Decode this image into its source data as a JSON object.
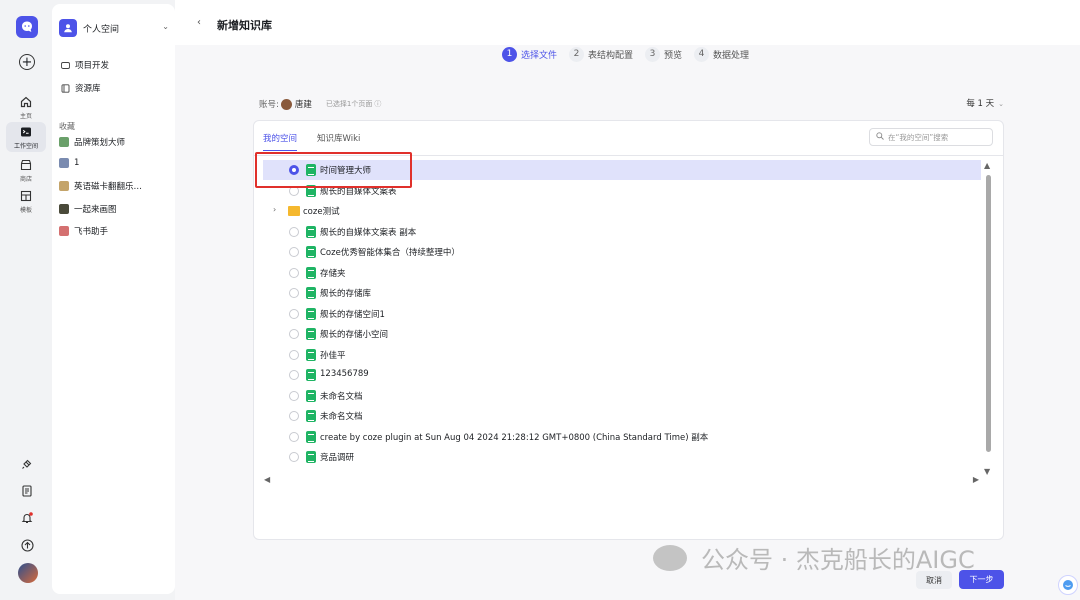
{
  "rail": {
    "items": [
      {
        "label": "主页",
        "icon": "home-icon"
      },
      {
        "label": "工作空间",
        "icon": "workspace-icon"
      },
      {
        "label": "商店",
        "icon": "store-icon"
      },
      {
        "label": "模板",
        "icon": "template-icon"
      }
    ],
    "bottom_icons": [
      "plugin-icon",
      "doc-icon",
      "bell-icon",
      "upload-icon"
    ],
    "notification_color": "#e0302b",
    "accent": "#4d53e8"
  },
  "sidebar": {
    "space_name": "个人空间",
    "nav": [
      {
        "label": "项目开发",
        "icon": "project-icon"
      },
      {
        "label": "资源库",
        "icon": "library-icon"
      }
    ],
    "favorites_title": "收藏",
    "favorites": [
      {
        "label": "品牌策划大师",
        "color": "#6aa06a"
      },
      {
        "label": "1",
        "color": "#7a8bb0"
      },
      {
        "label": "英语磁卡翻翻乐…",
        "color": "#c4a46a"
      },
      {
        "label": "一起来画图",
        "color": "#4a4a3a"
      },
      {
        "label": "飞书助手",
        "color": "#d47070"
      }
    ]
  },
  "header": {
    "title": "新增知识库"
  },
  "steps": [
    {
      "num": "1",
      "label": "选择文件"
    },
    {
      "num": "2",
      "label": "表结构配置"
    },
    {
      "num": "3",
      "label": "预览"
    },
    {
      "num": "4",
      "label": "数据处理"
    }
  ],
  "account": {
    "label": "账号:",
    "name": "唐建",
    "hint": "已选择1个页面",
    "frequency": "每 1 天"
  },
  "panel": {
    "tabs": [
      "我的空间",
      "知识库Wiki"
    ],
    "search_placeholder": "在“我的空间”搜索",
    "items": [
      {
        "name": "时间管理大师",
        "type": "sheet",
        "selected": true
      },
      {
        "name": "舰长的自媒体文案表",
        "type": "sheet",
        "selected": false
      },
      {
        "name": "coze测试",
        "type": "folder",
        "selected": false
      },
      {
        "name": "舰长的自媒体文案表 副本",
        "type": "sheet",
        "selected": false
      },
      {
        "name": "Coze优秀智能体集合（持续整理中）",
        "type": "sheet",
        "selected": false
      },
      {
        "name": "存储夹",
        "type": "sheet",
        "selected": false
      },
      {
        "name": "舰长的存储库",
        "type": "sheet",
        "selected": false
      },
      {
        "name": "舰长的存储空间1",
        "type": "sheet",
        "selected": false
      },
      {
        "name": "舰长的存储小空间",
        "type": "sheet",
        "selected": false
      },
      {
        "name": "孙佳平",
        "type": "sheet",
        "selected": false
      },
      {
        "name": "123456789",
        "type": "sheet",
        "selected": false
      },
      {
        "name": "未命名文档",
        "type": "sheet",
        "selected": false
      },
      {
        "name": "未命名文档",
        "type": "sheet",
        "selected": false
      },
      {
        "name": "create by coze plugin at Sun Aug 04 2024 21:28:12 GMT+0800 (China Standard Time) 副本",
        "type": "sheet",
        "selected": false
      },
      {
        "name": "竞品调研",
        "type": "sheet",
        "selected": false
      }
    ]
  },
  "buttons": {
    "cancel": "取消",
    "next": "下一步"
  },
  "watermark": "公众号 · 杰克船长的AIGC"
}
